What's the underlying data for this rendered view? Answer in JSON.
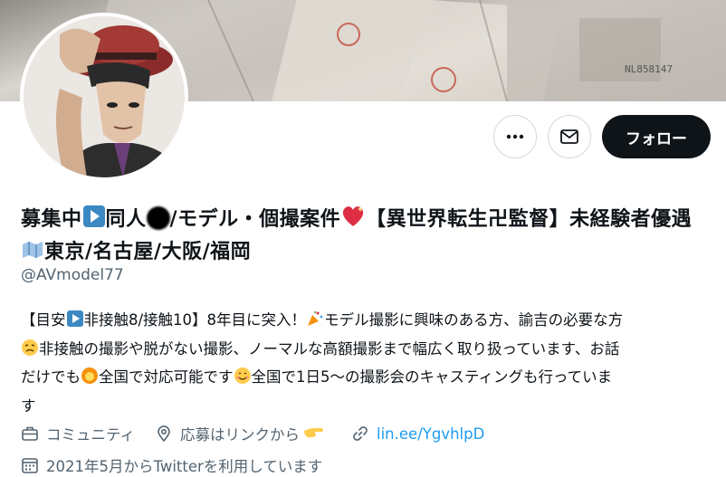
{
  "profile": {
    "display_name_parts": {
      "p1": "募集中",
      "p2": "同人",
      "p3": "/モデル・個撮案件",
      "p4": "【異世界転生卍監督】未経験者優遇",
      "p5": "東京/名古屋/大阪/福岡"
    },
    "handle": "@AVmodel77",
    "bio": {
      "l1a": "【目安",
      "l1b": "非接触8/接触10】8年目に突入！",
      "l1c": "モデル撮影に興味のある方、諭吉の必要な方",
      "l2": "非接触の撮影や脱がない撮影、ノーマルな高額撮影まで幅広く取り扱っています、お話",
      "l3a": "だけでも",
      "l3b": "全国で対応可能です",
      "l3c": "全国で1日5〜の撮影会のキャスティングも行っていま",
      "l4": "す"
    },
    "category": "コミュニティ",
    "location": "応募はリンクから",
    "url": "lin.ee/YgvhlpD",
    "joined": "2021年5月からTwitterを利用しています"
  },
  "actions": {
    "follow_label": "フォロー"
  },
  "icons": [
    "more-icon",
    "mail-icon",
    "briefcase-icon",
    "location-pin-icon",
    "link-icon",
    "calendar-icon"
  ],
  "colors": {
    "accent": "#1d9bf0",
    "text": "#0f1419",
    "secondary": "#536471",
    "follow_bg": "#0f1419"
  }
}
